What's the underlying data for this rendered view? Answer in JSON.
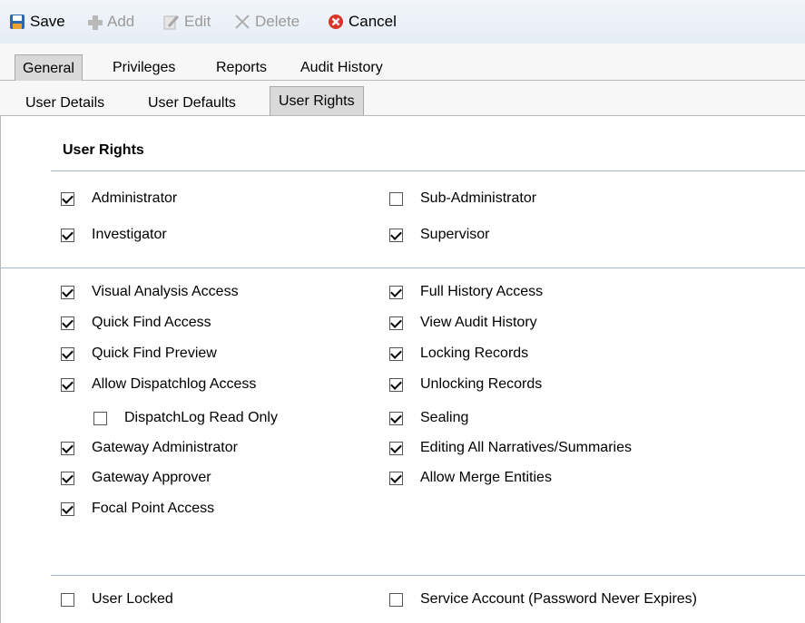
{
  "toolbar": {
    "save": "Save",
    "add": "Add",
    "edit": "Edit",
    "delete": "Delete",
    "cancel": "Cancel"
  },
  "tabs_main": [
    "General",
    "Privileges",
    "Reports",
    "Audit History"
  ],
  "tabs_sub": [
    "User Details",
    "User Defaults",
    "User Rights"
  ],
  "section_title": "User Rights",
  "roles_left": [
    {
      "label": "Administrator",
      "checked": true
    },
    {
      "label": "Investigator",
      "checked": true
    }
  ],
  "roles_right": [
    {
      "label": "Sub-Administrator",
      "checked": false
    },
    {
      "label": "Supervisor",
      "checked": true
    }
  ],
  "rights_left": [
    {
      "label": "Visual Analysis Access",
      "checked": true
    },
    {
      "label": "Quick Find Access",
      "checked": true
    },
    {
      "label": "Quick Find Preview",
      "checked": true
    },
    {
      "label": "Allow Dispatchlog Access",
      "checked": true
    },
    {
      "label": "DispatchLog Read Only",
      "checked": false
    },
    {
      "label": "Gateway Administrator",
      "checked": true
    },
    {
      "label": "Gateway Approver",
      "checked": true
    },
    {
      "label": "Focal Point Access",
      "checked": true
    }
  ],
  "rights_right": [
    {
      "label": "Full History Access",
      "checked": true
    },
    {
      "label": "View Audit History",
      "checked": true
    },
    {
      "label": "Locking Records",
      "checked": true
    },
    {
      "label": "Unlocking Records",
      "checked": true
    },
    {
      "label": "Sealing",
      "checked": true
    },
    {
      "label": "Editing All Narratives/Summaries",
      "checked": true
    },
    {
      "label": "Allow Merge Entities",
      "checked": true
    }
  ],
  "account": [
    {
      "label": "User Locked",
      "checked": false
    },
    {
      "label": "Service Account (Password Never Expires)",
      "checked": false
    }
  ]
}
